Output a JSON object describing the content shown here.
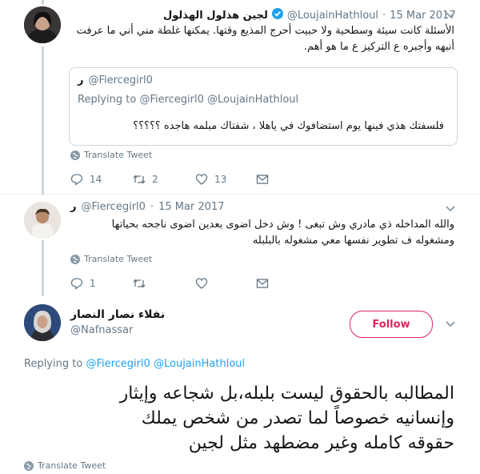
{
  "tweet1": {
    "display_name": "لجين هذلول الهذلول",
    "handle": "@LoujainHathloul",
    "date": "15 Mar 2017",
    "line1": "الأسئلة كانت سيئة وسطحية ولا حبيت أحرج المذيع وقتها. يمكنها غلطة مني أني ما عرفت",
    "line2": "أنبهه وأجبره ع التركيز ع ما هو أهم.",
    "quote": {
      "display_name": "ر",
      "handle": "@Fiercegirl0",
      "replying_prefix": "Replying to",
      "replying_users": "@Fiercegirl0 @LoujainHathloul",
      "text": "فلسفتك هذي فينها يوم استضافوك في ياهلا ، شفتاك مبلمه هاجده ؟؟؟؟؟"
    },
    "translate_label": "Translate Tweet",
    "replies": "14",
    "retweets": "2",
    "likes": "13"
  },
  "tweet2": {
    "display_name": "ر",
    "handle": "@Fiercegirl0",
    "date": "15 Mar 2017",
    "line1": "والله المداخله ذي مادري وش تبغى ! وش دخل اضوى بعدين اضوى ناجحه بحياتها",
    "line2": "ومشغوله ف تطوير نفسها معي مشغوله بالبلبله",
    "translate_label": "Translate Tweet",
    "replies": "1",
    "retweets": "",
    "likes": ""
  },
  "tweet3": {
    "display_name": "نفلاء نصار النصار",
    "handle": "@Nafnassar",
    "follow_label": "Follow",
    "replying_prefix": "Replying to",
    "replying_users": "@Fiercegirl0 @LoujainHathloul",
    "line1": "المطالبه بالحقوق ليست بلبله،بل شجاعه وإيثار",
    "line2": "وإنسانيه خصوصاً لما تصدر من شخص يملك",
    "line3": "حقوقه كامله وغير مضطهد مثل لجين",
    "translate_label": "Translate Tweet"
  },
  "icons": {
    "verified": "verified-badge-icon",
    "caret": "chevron-down-icon",
    "globe": "globe-icon",
    "reply": "reply-icon",
    "retweet": "retweet-icon",
    "like": "heart-icon",
    "dm": "envelope-icon"
  },
  "colors": {
    "link": "#1da1f2",
    "muted": "#657786",
    "follow": "#e0245e",
    "thread": "#ccd6dd",
    "verified": "#1da1f2"
  }
}
